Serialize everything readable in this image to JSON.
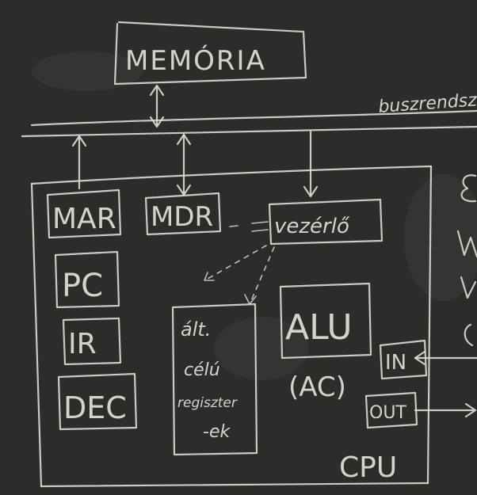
{
  "memory": {
    "label": "MEMÓRIA"
  },
  "bus": {
    "label": "buszrendszer"
  },
  "cpu": {
    "label": "CPU",
    "registers": {
      "mar": "MAR",
      "mdr": "MDR",
      "pc": "PC",
      "ir": "IR",
      "dec": "DEC"
    },
    "control": "vezérlő",
    "alu": "ALU",
    "accumulator": "(AC)",
    "general_registers": [
      "ált.",
      "célú",
      "regiszter",
      "-ek"
    ],
    "io": {
      "in": "IN",
      "out": "OUT"
    }
  },
  "colors": {
    "board": "#2b2d2a",
    "chalk": "#dcdcd4"
  }
}
